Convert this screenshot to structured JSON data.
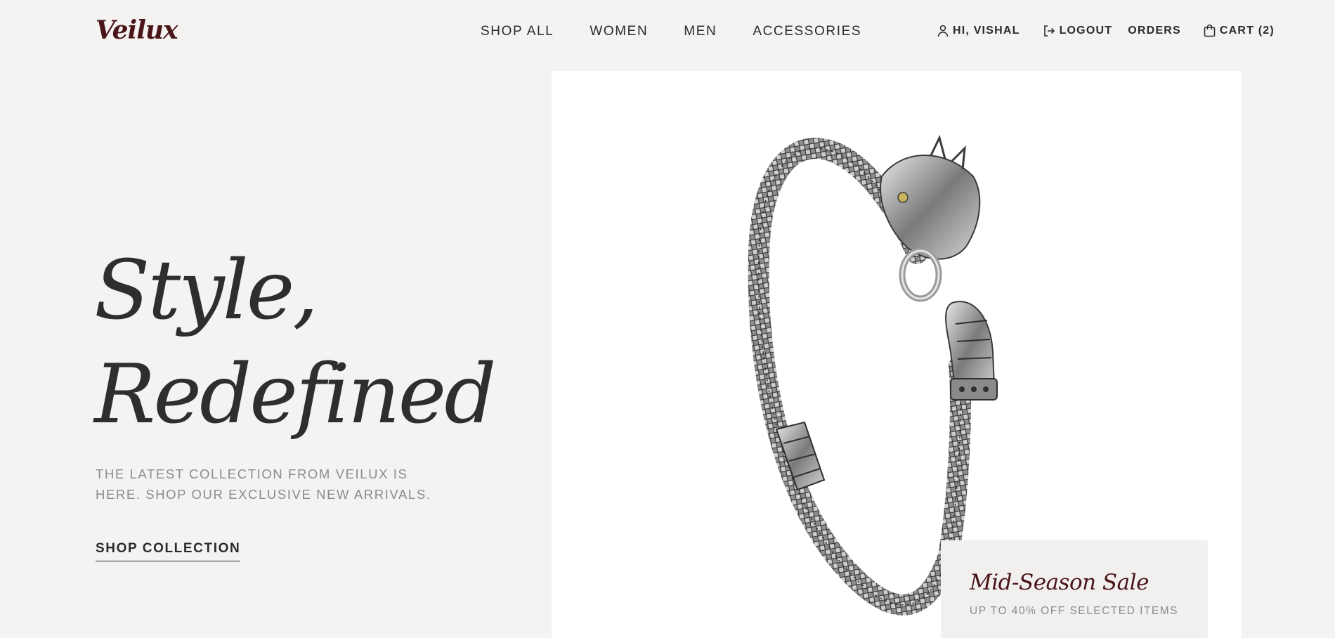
{
  "brand": {
    "logo": "Veilux",
    "accent_color": "#4a1518"
  },
  "nav": {
    "items": [
      {
        "label": "SHOP ALL"
      },
      {
        "label": "WOMEN"
      },
      {
        "label": "MEN"
      },
      {
        "label": "ACCESSORIES"
      }
    ]
  },
  "account": {
    "greeting": "HI, VISHAL",
    "greeting_icon": "user-icon",
    "logout_label": "LOGOUT",
    "logout_icon": "logout-icon",
    "orders_label": "ORDERS",
    "cart_label": "CART (2)",
    "cart_icon": "shopping-bag-icon"
  },
  "hero": {
    "headline_line1": "Style,",
    "headline_line2": "Redefined",
    "subtitle_line1": "THE LATEST COLLECTION FROM VEILUX IS",
    "subtitle_line2": "HERE. SHOP OUR EXCLUSIVE NEW ARRIVALS.",
    "cta_label": "SHOP COLLECTION",
    "image_subject": "silver dragon-head chain bracelet"
  },
  "promo": {
    "title": "Mid-Season Sale",
    "subtitle": "UP TO 40% OFF SELECTED ITEMS"
  }
}
